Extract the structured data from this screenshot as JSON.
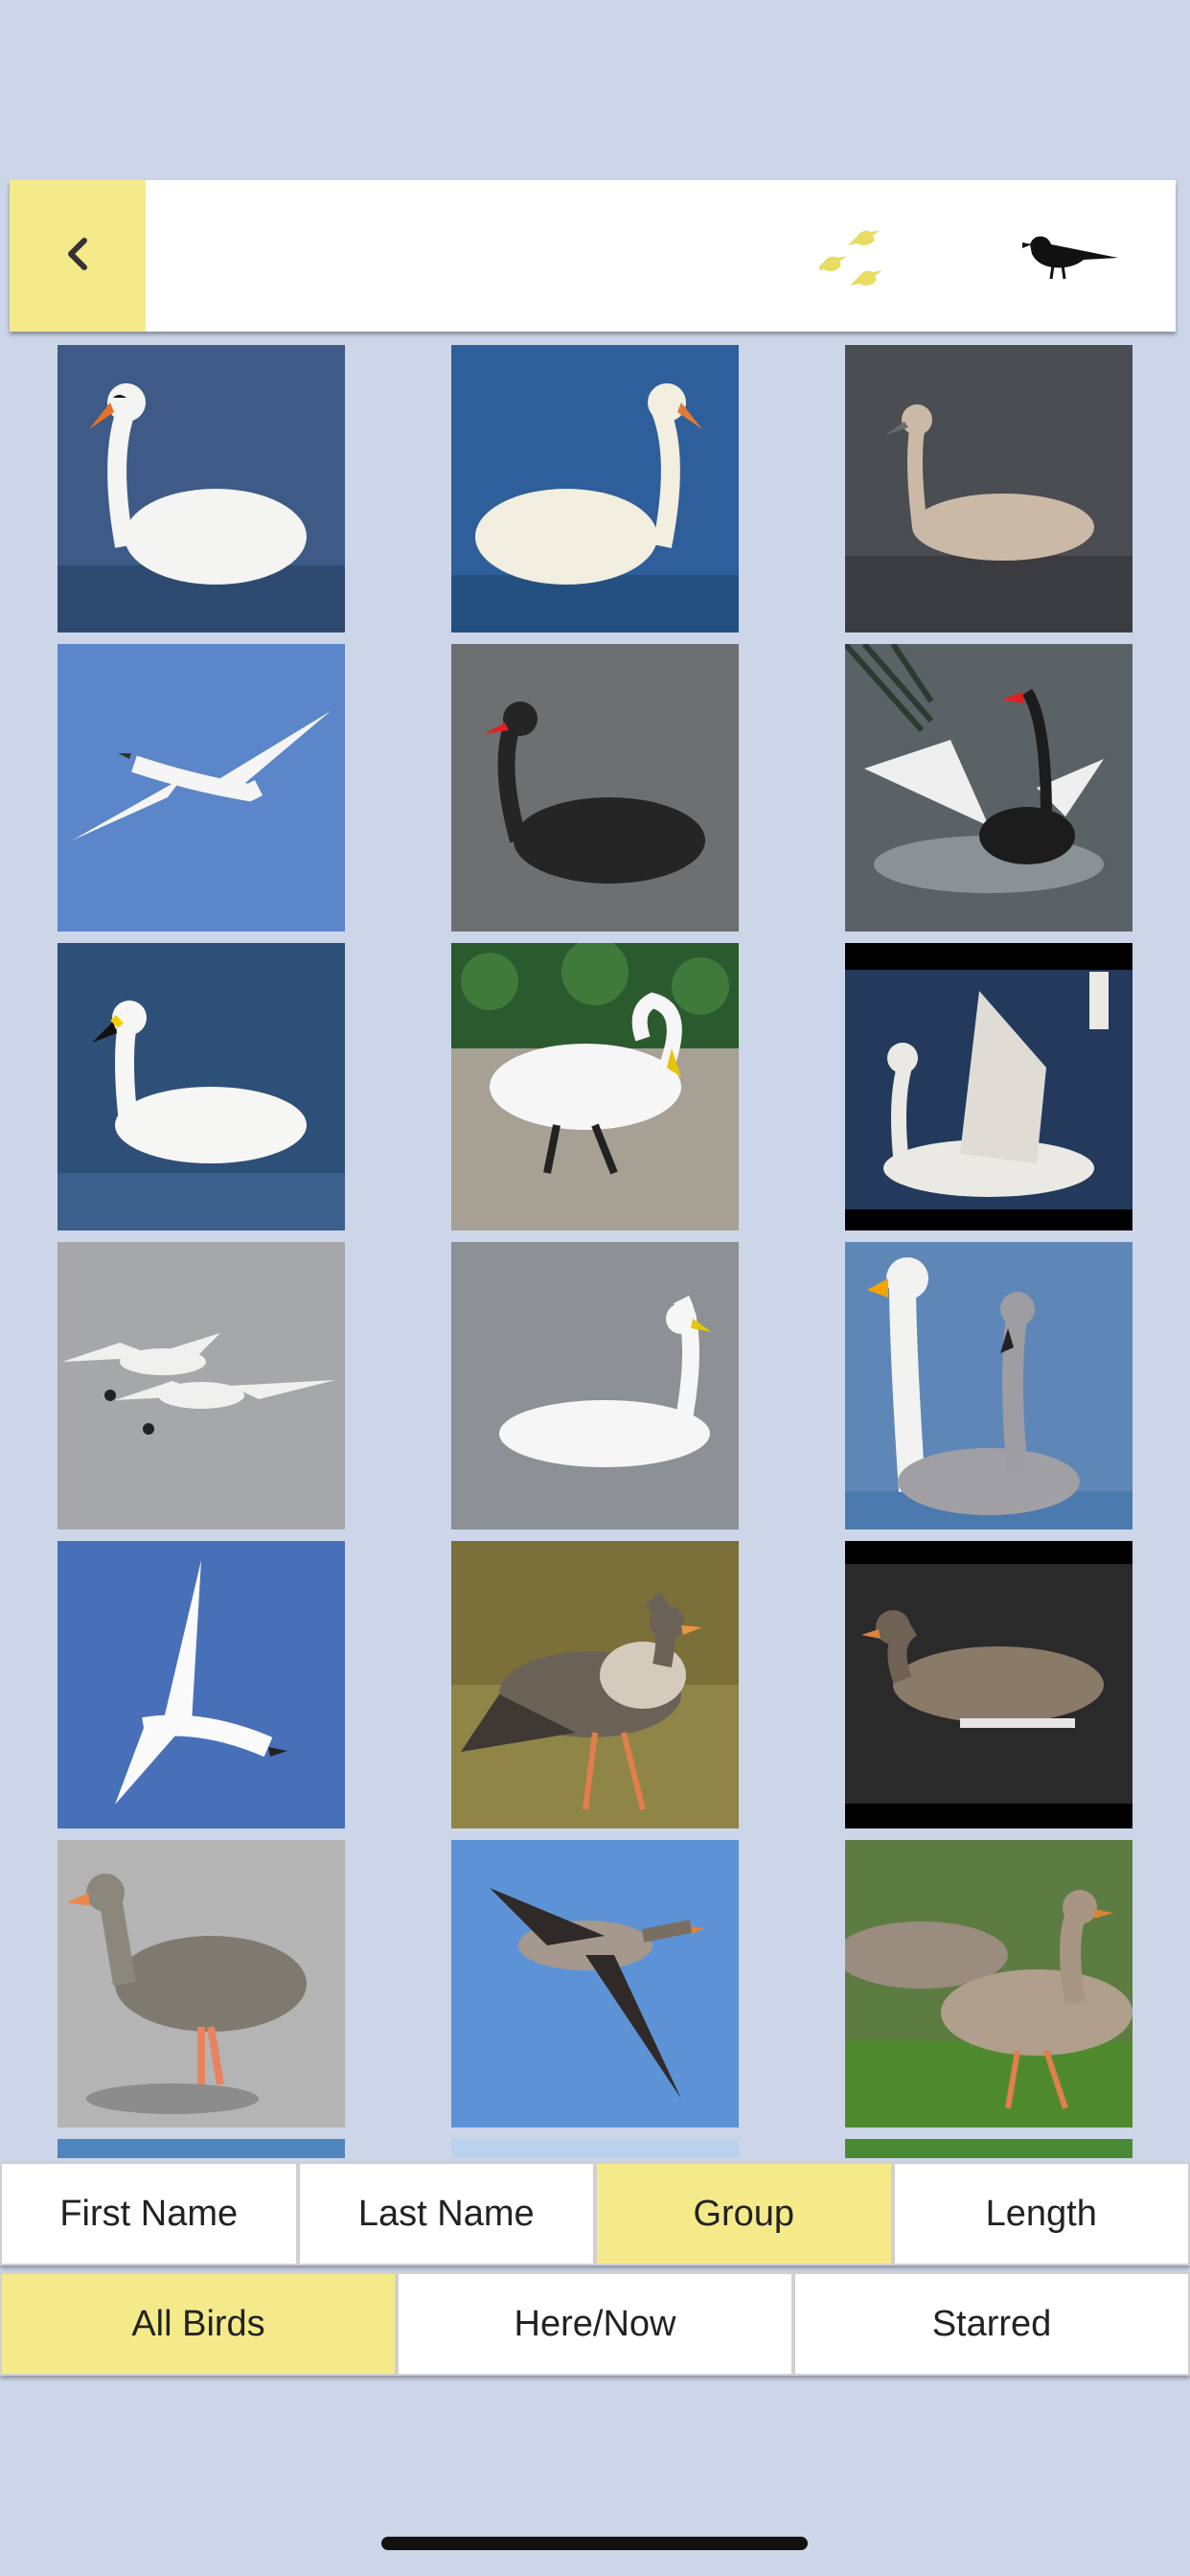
{
  "toolbar": {
    "back_icon": "chevron-left-icon",
    "flock_icon": "bird-flock-icon",
    "single_bird_icon": "single-bird-icon",
    "accent": "#f4ea8a"
  },
  "grid": {
    "photos": [
      {
        "subject": "mute-swan-swimming"
      },
      {
        "subject": "mute-swan-swimming-2"
      },
      {
        "subject": "juvenile-swan"
      },
      {
        "subject": "swan-in-flight"
      },
      {
        "subject": "black-swan"
      },
      {
        "subject": "black-swan-wings-spread"
      },
      {
        "subject": "bewicks-swan"
      },
      {
        "subject": "swan-on-gravel"
      },
      {
        "subject": "swan-wings-raised"
      },
      {
        "subject": "swans-in-flight-pair"
      },
      {
        "subject": "whooper-swan"
      },
      {
        "subject": "whooper-swan-with-juvenile"
      },
      {
        "subject": "swan-flying-blue-sky"
      },
      {
        "subject": "goose-on-grass"
      },
      {
        "subject": "goose-swimming"
      },
      {
        "subject": "greylag-goose-standing"
      },
      {
        "subject": "goose-in-flight"
      },
      {
        "subject": "pink-footed-goose-flock"
      }
    ]
  },
  "sort_tabs": [
    {
      "label": "First Name",
      "active": false
    },
    {
      "label": "Last Name",
      "active": false
    },
    {
      "label": "Group",
      "active": true
    },
    {
      "label": "Length",
      "active": false
    }
  ],
  "filter_tabs": [
    {
      "label": "All Birds",
      "active": true
    },
    {
      "label": "Here/Now",
      "active": false
    },
    {
      "label": "Starred",
      "active": false
    }
  ]
}
